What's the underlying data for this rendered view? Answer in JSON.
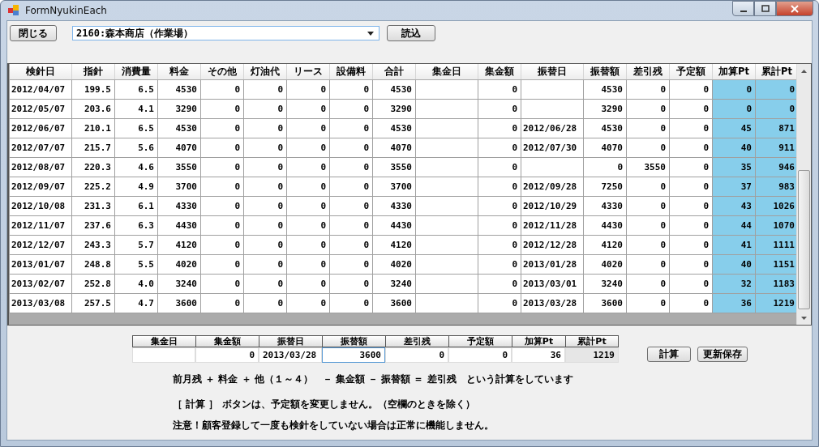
{
  "window": {
    "title": "FormNyukinEach"
  },
  "toolbar": {
    "close_button": "閉じる",
    "customer_combo": {
      "value": "2160:森本商店（作業場）"
    },
    "load_button": "読込"
  },
  "grid": {
    "columns": [
      {
        "label": "検針日",
        "kind": "date",
        "highlighted": false
      },
      {
        "label": "指針",
        "kind": "number",
        "highlighted": false
      },
      {
        "label": "消費量",
        "kind": "number",
        "highlighted": false
      },
      {
        "label": "料金",
        "kind": "number",
        "highlighted": false
      },
      {
        "label": "その他",
        "kind": "number",
        "highlighted": false
      },
      {
        "label": "灯油代",
        "kind": "number",
        "highlighted": false
      },
      {
        "label": "リース",
        "kind": "number",
        "highlighted": false
      },
      {
        "label": "設備料",
        "kind": "number",
        "highlighted": false
      },
      {
        "label": "合計",
        "kind": "number",
        "highlighted": false
      },
      {
        "label": "集金日",
        "kind": "date",
        "highlighted": false
      },
      {
        "label": "集金額",
        "kind": "number",
        "highlighted": false
      },
      {
        "label": "振替日",
        "kind": "date",
        "highlighted": false
      },
      {
        "label": "振替額",
        "kind": "number",
        "highlighted": false
      },
      {
        "label": "差引残",
        "kind": "number",
        "highlighted": false
      },
      {
        "label": "予定額",
        "kind": "number",
        "highlighted": false
      },
      {
        "label": "加算Pt",
        "kind": "number",
        "highlighted": true
      },
      {
        "label": "累計Pt",
        "kind": "number",
        "highlighted": true
      }
    ],
    "rows": [
      [
        "2012/04/07",
        "199.5",
        "6.5",
        "4530",
        "0",
        "0",
        "0",
        "0",
        "4530",
        null,
        "0",
        null,
        "4530",
        "0",
        "0",
        "0",
        "0"
      ],
      [
        "2012/05/07",
        "203.6",
        "4.1",
        "3290",
        "0",
        "0",
        "0",
        "0",
        "3290",
        null,
        "0",
        null,
        "3290",
        "0",
        "0",
        "0",
        "0"
      ],
      [
        "2012/06/07",
        "210.1",
        "6.5",
        "4530",
        "0",
        "0",
        "0",
        "0",
        "4530",
        null,
        "0",
        "2012/06/28",
        "4530",
        "0",
        "0",
        "45",
        "871"
      ],
      [
        "2012/07/07",
        "215.7",
        "5.6",
        "4070",
        "0",
        "0",
        "0",
        "0",
        "4070",
        null,
        "0",
        "2012/07/30",
        "4070",
        "0",
        "0",
        "40",
        "911"
      ],
      [
        "2012/08/07",
        "220.3",
        "4.6",
        "3550",
        "0",
        "0",
        "0",
        "0",
        "3550",
        null,
        "0",
        null,
        "0",
        "3550",
        "0",
        "35",
        "946"
      ],
      [
        "2012/09/07",
        "225.2",
        "4.9",
        "3700",
        "0",
        "0",
        "0",
        "0",
        "3700",
        null,
        "0",
        "2012/09/28",
        "7250",
        "0",
        "0",
        "37",
        "983"
      ],
      [
        "2012/10/08",
        "231.3",
        "6.1",
        "4330",
        "0",
        "0",
        "0",
        "0",
        "4330",
        null,
        "0",
        "2012/10/29",
        "4330",
        "0",
        "0",
        "43",
        "1026"
      ],
      [
        "2012/11/07",
        "237.6",
        "6.3",
        "4430",
        "0",
        "0",
        "0",
        "0",
        "4430",
        null,
        "0",
        "2012/11/28",
        "4430",
        "0",
        "0",
        "44",
        "1070"
      ],
      [
        "2012/12/07",
        "243.3",
        "5.7",
        "4120",
        "0",
        "0",
        "0",
        "0",
        "4120",
        null,
        "0",
        "2012/12/28",
        "4120",
        "0",
        "0",
        "41",
        "1111"
      ],
      [
        "2013/01/07",
        "248.8",
        "5.5",
        "4020",
        "0",
        "0",
        "0",
        "0",
        "4020",
        null,
        "0",
        "2013/01/28",
        "4020",
        "0",
        "0",
        "40",
        "1151"
      ],
      [
        "2013/02/07",
        "252.8",
        "4.0",
        "3240",
        "0",
        "0",
        "0",
        "0",
        "3240",
        null,
        "0",
        "2013/03/01",
        "3240",
        "0",
        "0",
        "32",
        "1183"
      ],
      [
        "2013/03/08",
        "257.5",
        "4.7",
        "3600",
        "0",
        "0",
        "0",
        "0",
        "3600",
        null,
        "0",
        "2013/03/28",
        "3600",
        "0",
        "0",
        "36",
        "1219"
      ]
    ]
  },
  "edit_row": {
    "fields": [
      {
        "label": "集金日",
        "focused": false,
        "readonly": false
      },
      {
        "label": "集金額",
        "value": "0",
        "focused": false,
        "readonly": false
      },
      {
        "label": "振替日",
        "value": "2013/03/28",
        "kind": "date",
        "focused": false,
        "readonly": false
      },
      {
        "label": "振替額",
        "value": "3600",
        "focused": true,
        "readonly": false
      },
      {
        "label": "差引残",
        "value": "0",
        "focused": false,
        "readonly": false
      },
      {
        "label": "予定額",
        "value": "0",
        "focused": false,
        "readonly": false
      },
      {
        "label": "加算Pt",
        "value": "36",
        "focused": false,
        "readonly": false
      },
      {
        "label": "累計Pt",
        "value": "1219",
        "focused": false,
        "readonly": true
      }
    ],
    "buttons": [
      "計算",
      "更新保存"
    ]
  },
  "notes": [
    "前月残 ＋ 料金 ＋ 他（１～４）　－ 集金額 － 振替額 ＝ 差引残　という計算をしています",
    "［ 計算 ］ ボタンは、予定額を変更しません。（空欄のときを除く）",
    "注意！顧客登録して一度も検針をしていない場合は正常に機能しません。"
  ]
}
